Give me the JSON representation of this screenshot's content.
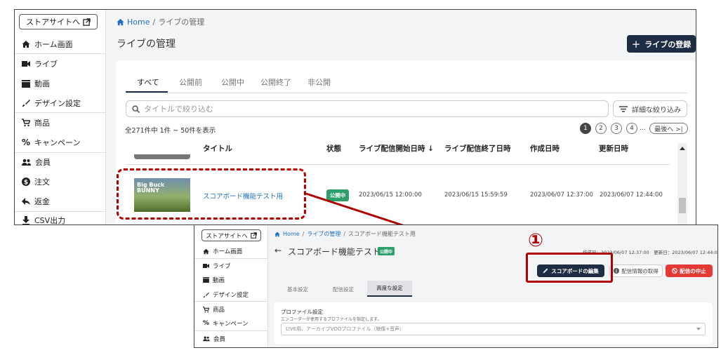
{
  "sidebar": {
    "store_label": "ストアサイトへ",
    "items": [
      {
        "label": "ホーム画面",
        "icon": "home-icon"
      },
      {
        "label": "ライブ",
        "icon": "video-camera-icon"
      },
      {
        "label": "動画",
        "icon": "clapperboard-icon"
      },
      {
        "label": "デザイン設定",
        "icon": "brush-icon"
      },
      {
        "label": "商品",
        "icon": "cart-icon"
      },
      {
        "label": "キャンペーン",
        "icon": "percent-icon"
      },
      {
        "label": "会員",
        "icon": "people-icon"
      },
      {
        "label": "注文",
        "icon": "dollar-icon"
      },
      {
        "label": "返金",
        "icon": "reply-icon"
      },
      {
        "label": "CSV出力",
        "icon": "download-icon"
      }
    ]
  },
  "main": {
    "breadcrumb": {
      "home": "Home",
      "sep": "/",
      "current": "ライブの管理"
    },
    "title": "ライブの管理",
    "register_button": "ライブの登録",
    "tabs": [
      "すべて",
      "公開前",
      "公開中",
      "公開終了",
      "非公開"
    ],
    "search_placeholder": "タイトルで絞り込む",
    "filter_button": "詳細な絞り込み",
    "count_text": "全271件中 1件 ~ 50件を表示",
    "pagination": {
      "pages": [
        "1",
        "2",
        "3",
        "4"
      ],
      "ellipsis": "...",
      "last": "最後へ >|"
    },
    "columns": [
      "タイトル",
      "状態",
      "ライブ配信開始日時 ↓",
      "ライブ配信終了日時",
      "作成日時",
      "更新日時"
    ],
    "row": {
      "thumb_text": "Big Buck BUNNY",
      "title": "スコアボード機能テスト用",
      "status": "公開中",
      "start": "2023/06/15 12:00:00",
      "end": "2023/06/15 15:59:59",
      "created": "2023/06/07 12:37:00",
      "updated": "2023/06/07 12:44:00"
    }
  },
  "detail": {
    "store_label": "ストアサイトへ",
    "items": [
      "ホーム画面",
      "ライブ",
      "動画",
      "デザイン設定",
      "商品",
      "キャンペーン",
      "会員"
    ],
    "breadcrumb": {
      "home": "Home",
      "mid": "ライブの管理",
      "current": "スコアボード機能テスト用"
    },
    "title": "スコアボード機能テスト用",
    "status": "公開中",
    "dates": "作成日：2023/06/07 12:37:00　更新日：2023/06/07 12:44:00",
    "buttons": {
      "scoreboard": "スコアボードの編集",
      "info": "配信情報の取得",
      "stop": "配信の中止"
    },
    "tabs": [
      "基本設定",
      "配信設定",
      "高度な設定"
    ],
    "profile_title": "プロファイル設定",
    "profile_desc": "エンコーダーが使用するプロファイルを指定します。",
    "profile_value": "LIVE用、アーカイブVODプロファイル（映像+音声）"
  },
  "annotation": {
    "step": "①"
  },
  "colors": {
    "accent": "#1f2d44",
    "highlight": "#b00000",
    "status_green": "#2e9e6b",
    "stop_red": "#e53935",
    "link": "#1e6fbf"
  }
}
